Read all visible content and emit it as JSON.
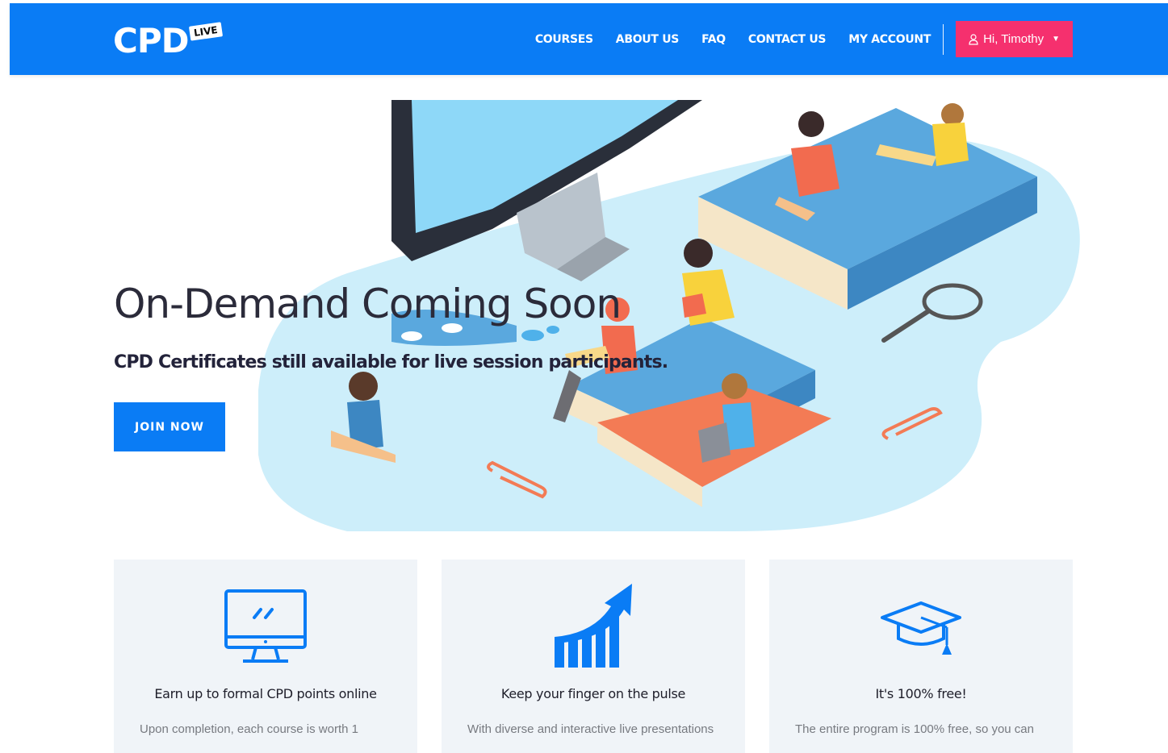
{
  "header": {
    "logo_text": "CPD",
    "logo_badge": "LIVE",
    "nav": [
      "COURSES",
      "ABOUT US",
      "FAQ",
      "CONTACT US",
      "MY ACCOUNT"
    ],
    "user_label": "Hi, Timothy"
  },
  "hero": {
    "title": "On-Demand Coming Soon",
    "subtitle": "CPD Certificates still available for live session participants.",
    "cta": "JOIN NOW"
  },
  "features": [
    {
      "icon": "monitor-icon",
      "title": "Earn up to formal CPD points online",
      "text": "Upon completion, each course is worth 1"
    },
    {
      "icon": "growth-chart-icon",
      "title": "Keep your finger on the pulse",
      "text": "With diverse and interactive live presentations"
    },
    {
      "icon": "graduation-cap-icon",
      "title": "It's 100% free!",
      "text": "The entire program is 100% free, so you can"
    }
  ],
  "colors": {
    "brand_blue": "#0a7cf5",
    "accent_pink": "#f5306e",
    "card_bg": "#f0f4f8"
  }
}
